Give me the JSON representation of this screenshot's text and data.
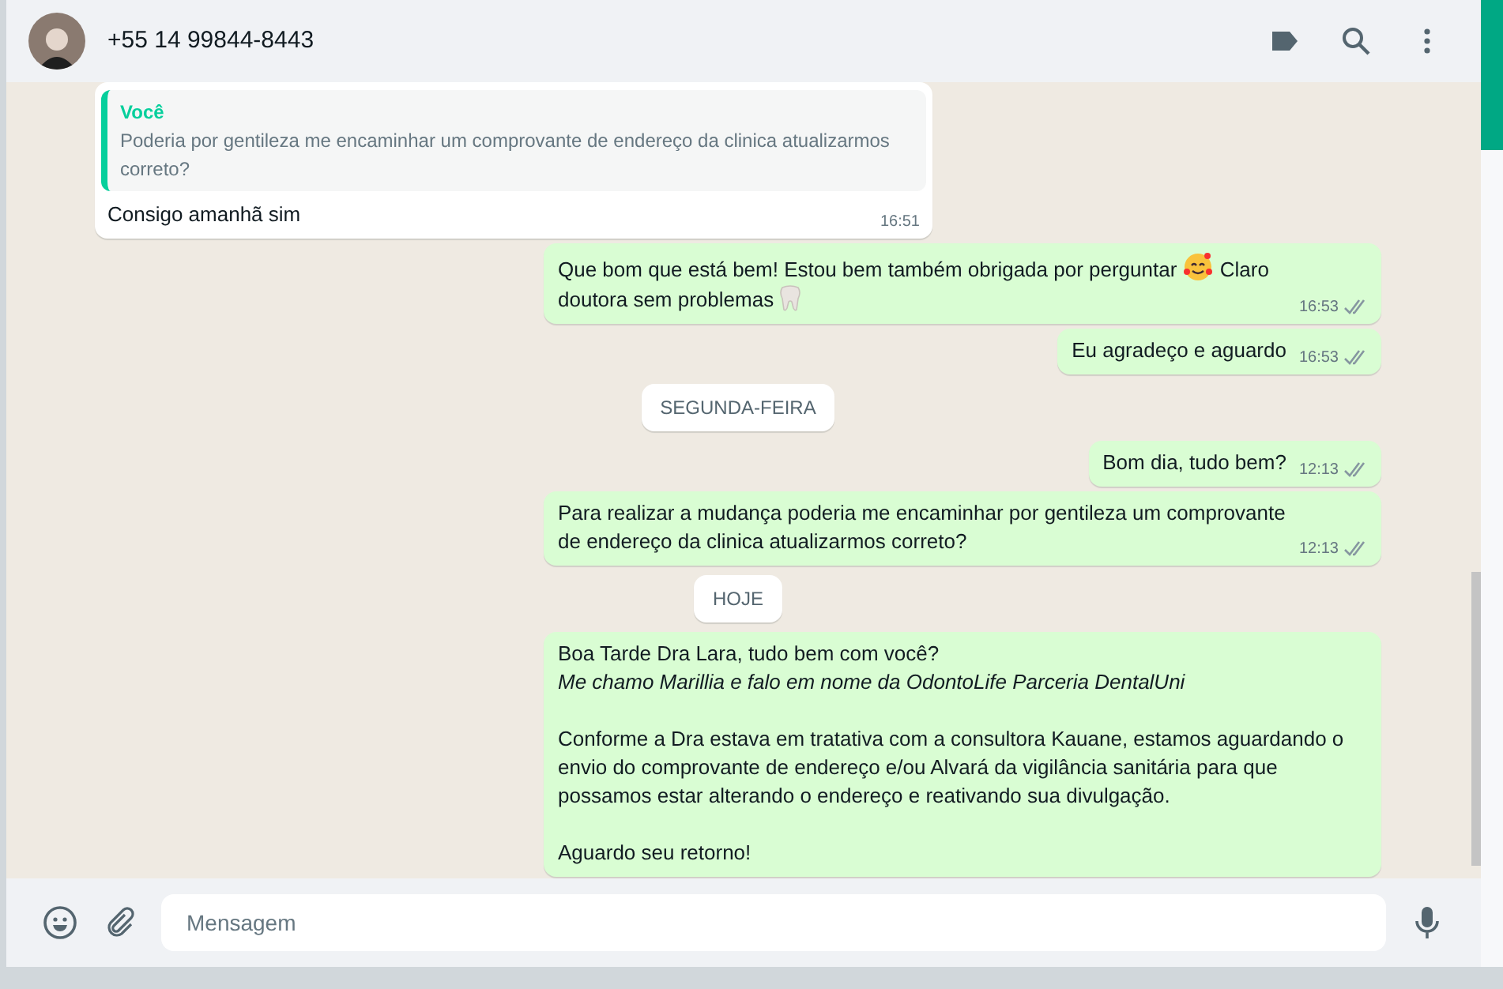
{
  "header": {
    "title": "+55 14 99844-8443"
  },
  "messages": [
    {
      "kind": "in",
      "quote": {
        "author": "Você",
        "text": "Poderia por gentileza me encaminhar um comprovante de endereço da clinica atualizarmos correto?"
      },
      "parts": [
        {
          "kind": "text",
          "text": "Consigo amanhã sim"
        }
      ],
      "time": "16:51"
    },
    {
      "kind": "out",
      "parts": [
        {
          "kind": "text",
          "text": "Que bom que está bem! Estou bem também obrigada por perguntar "
        },
        {
          "kind": "smiley"
        },
        {
          "kind": "text",
          "text": " Claro doutora sem problemas "
        },
        {
          "kind": "tooth"
        }
      ],
      "time": "16:53",
      "read": false
    },
    {
      "kind": "out",
      "parts": [
        {
          "kind": "text",
          "text": "Eu agradeço e aguardo"
        }
      ],
      "time": "16:53",
      "read": false
    },
    {
      "kind": "date",
      "text": "SEGUNDA-FEIRA"
    },
    {
      "kind": "out",
      "parts": [
        {
          "kind": "text",
          "text": "Bom dia, tudo bem?"
        }
      ],
      "time": "12:13",
      "read": false
    },
    {
      "kind": "out",
      "parts": [
        {
          "kind": "text",
          "text": "Para realizar a mudança poderia me encaminhar por gentileza um comprovante de endereço da clinica atualizarmos correto?"
        }
      ],
      "time": "12:13",
      "read": false
    },
    {
      "kind": "date",
      "text": "HOJE"
    },
    {
      "kind": "out",
      "parts": [
        {
          "kind": "text",
          "text": "Boa Tarde Dra Lara, tudo bem com você?\n*Me chamo Marillia e falo em nome da OdontoLife Parceria DentalUni*\n\nConforme a Dra estava em tratativa com a consultora Kauane, estamos aguardando o envio do comprovante de endereço e/ou Alvará da vigilância sanitária para que possamos estar alterando o endereço e reativando sua divulgação.\n\nAguardo seu retorno!"
        }
      ]
    }
  ],
  "composer": {
    "placeholder": "Mensagem"
  }
}
